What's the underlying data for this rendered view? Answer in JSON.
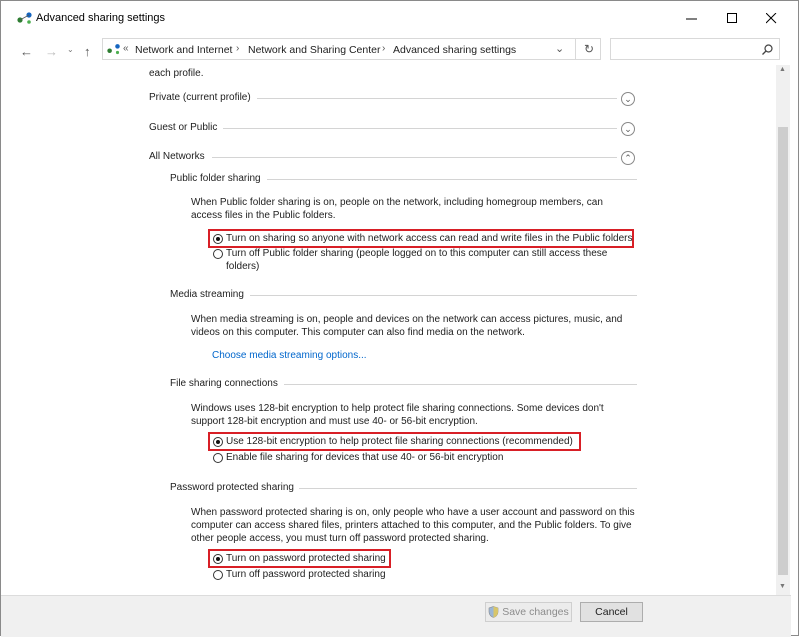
{
  "window": {
    "title": "Advanced sharing settings"
  },
  "address": {
    "crumbs": [
      "Network and Internet",
      "Network and Sharing Center",
      "Advanced sharing settings"
    ]
  },
  "search": {
    "placeholder": ""
  },
  "profiles": {
    "intro_tail": "each profile.",
    "private": "Private (current profile)",
    "guest": "Guest or Public",
    "all": "All Networks"
  },
  "public_folder": {
    "heading": "Public folder sharing",
    "desc1": "When Public folder sharing is on, people on the network, including homegroup members, can",
    "desc2": "access files in the Public folders.",
    "opt_on": "Turn on sharing so anyone with network access can read and write files in the Public folders",
    "opt_off_1": "Turn off Public folder sharing (people logged on to this computer can still access these",
    "opt_off_2": "folders)"
  },
  "media": {
    "heading": "Media streaming",
    "desc1": "When media streaming is on, people and devices on the network can access pictures, music, and",
    "desc2": "videos on this computer. This computer can also find media on the network.",
    "link": "Choose media streaming options..."
  },
  "file_sharing": {
    "heading": "File sharing connections",
    "desc1": "Windows uses 128-bit encryption to help protect file sharing connections. Some devices don't",
    "desc2": "support 128-bit encryption and must use 40- or 56-bit encryption.",
    "opt_128": "Use 128-bit encryption to help protect file sharing connections (recommended)",
    "opt_40": "Enable file sharing for devices that use 40- or 56-bit encryption"
  },
  "password": {
    "heading": "Password protected sharing",
    "desc1": "When password protected sharing is on, only people who have a user account and password on this",
    "desc2": "computer can access shared files, printers attached to this computer, and the Public folders. To give",
    "desc3": "other people access, you must turn off password protected sharing.",
    "opt_on": "Turn on password protected sharing",
    "opt_off": "Turn off password protected sharing"
  },
  "footer": {
    "save": "Save changes",
    "cancel": "Cancel"
  },
  "colors": {
    "highlight": "#d81f26",
    "link": "#0066cc"
  }
}
